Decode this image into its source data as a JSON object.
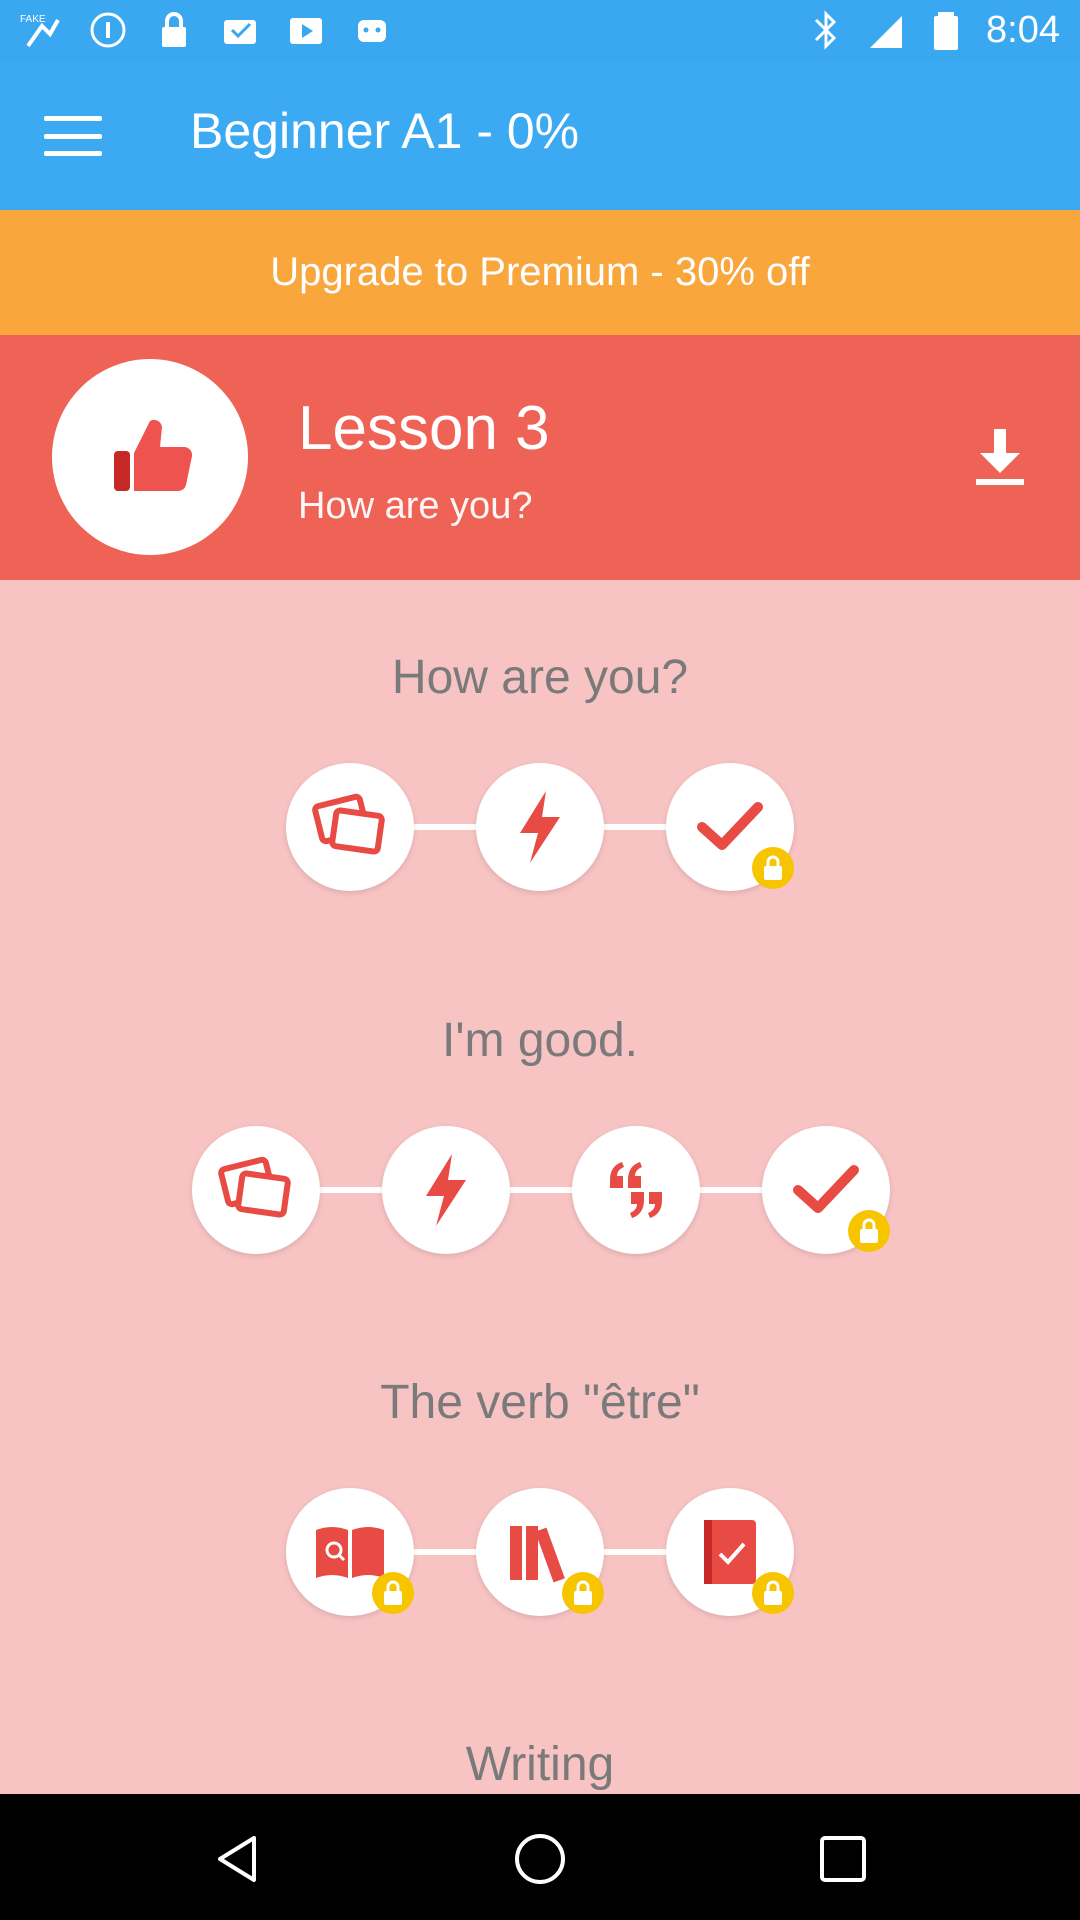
{
  "status_bar": {
    "time": "8:04",
    "left_icons": [
      "fake-gps-icon",
      "info-icon",
      "lock-icon",
      "inbox-icon",
      "youtube-icon",
      "android-icon"
    ],
    "right_icons": [
      "bluetooth-icon",
      "signal-icon",
      "battery-icon"
    ]
  },
  "app_bar": {
    "title": "Beginner A1 - 0%",
    "menu_icon": "hamburger-icon"
  },
  "premium_banner": {
    "label": "Upgrade to Premium - 30% off"
  },
  "lesson": {
    "title": "Lesson 3",
    "subtitle": "How are you?",
    "badge_icon": "thumbs-up-icon",
    "download_icon": "download-icon"
  },
  "sections": [
    {
      "title": "How are you?",
      "steps": [
        {
          "icon": "flashcards-icon",
          "locked": false
        },
        {
          "icon": "lightning-icon",
          "locked": false
        },
        {
          "icon": "checkmark-icon",
          "locked": true
        }
      ]
    },
    {
      "title": "I'm good.",
      "steps": [
        {
          "icon": "flashcards-icon",
          "locked": false
        },
        {
          "icon": "lightning-icon",
          "locked": false
        },
        {
          "icon": "quotes-icon",
          "locked": false
        },
        {
          "icon": "checkmark-icon",
          "locked": true
        }
      ]
    },
    {
      "title": "The verb \"être\"",
      "steps": [
        {
          "icon": "book-search-icon",
          "locked": true
        },
        {
          "icon": "library-icon",
          "locked": true
        },
        {
          "icon": "notebook-check-icon",
          "locked": true
        }
      ]
    },
    {
      "title": "Writing",
      "steps": []
    }
  ],
  "nav_bar": {
    "buttons": [
      "back-icon",
      "home-icon",
      "recents-icon"
    ]
  },
  "colors": {
    "app_bar": "#3ca9f3",
    "premium": "#f9a63d",
    "lesson_header": "#ef6256",
    "background": "#f8c3c3",
    "accent_red": "#e84a44",
    "lock": "#f7c500"
  }
}
